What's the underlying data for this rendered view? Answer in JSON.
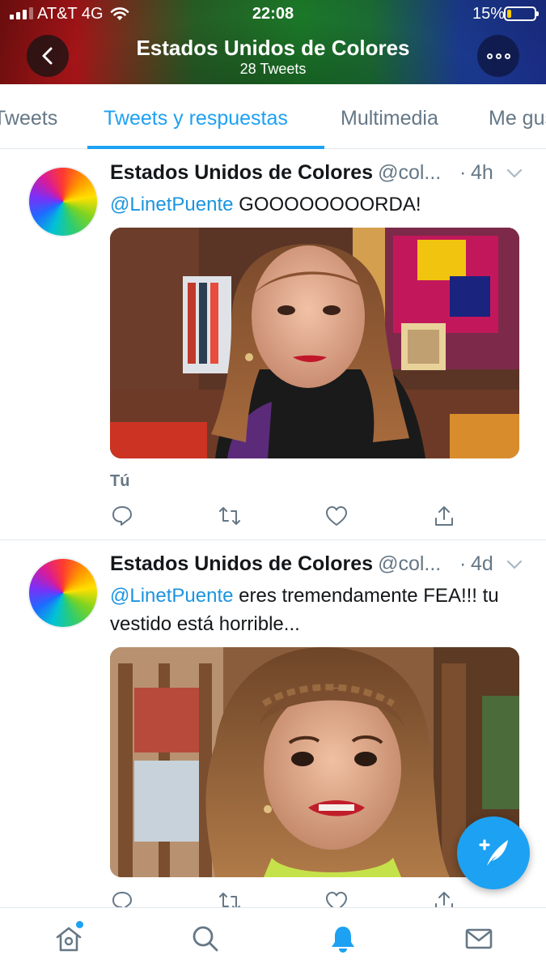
{
  "status_bar": {
    "carrier": "AT&T 4G",
    "time": "22:08",
    "battery_percent": "15%",
    "battery_level": 0.15
  },
  "header": {
    "title": "Estados Unidos de Colores",
    "subtitle": "28 Tweets"
  },
  "tabs": [
    {
      "label": "Tweets",
      "active": false
    },
    {
      "label": "Tweets y respuestas",
      "active": true
    },
    {
      "label": "Multimedia",
      "active": false
    },
    {
      "label": "Me gusta",
      "active": false
    }
  ],
  "tweets": [
    {
      "name": "Estados Unidos de Colores",
      "handle": "@col...",
      "dot": "·",
      "time": "4h",
      "mention": "@LinetPuente",
      "text": " GOOOOOOOORDA!",
      "footer_label": "Tú",
      "media": "photo of a woman with long wavy hair, red lipstick, colorful set behind"
    },
    {
      "name": "Estados Unidos de Colores",
      "handle": "@col...",
      "dot": "·",
      "time": "4d",
      "mention": "@LinetPuente",
      "text": " eres tremendamente FEA!!! tu vestido está horrible...",
      "media": "close-up photo of a woman with braided curly hair making a face"
    }
  ],
  "icons": {
    "back": "chevron-left-icon",
    "more": "more-options-icon",
    "reply": "reply-icon",
    "retweet": "retweet-icon",
    "like": "heart-icon",
    "share": "share-icon",
    "compose": "compose-tweet-icon",
    "home": "home-icon",
    "search": "search-icon",
    "notifications": "bell-icon",
    "messages": "mail-icon"
  },
  "colors": {
    "accent": "#1da1f2",
    "mention": "#1b95e0",
    "secondary_text": "#657786"
  }
}
